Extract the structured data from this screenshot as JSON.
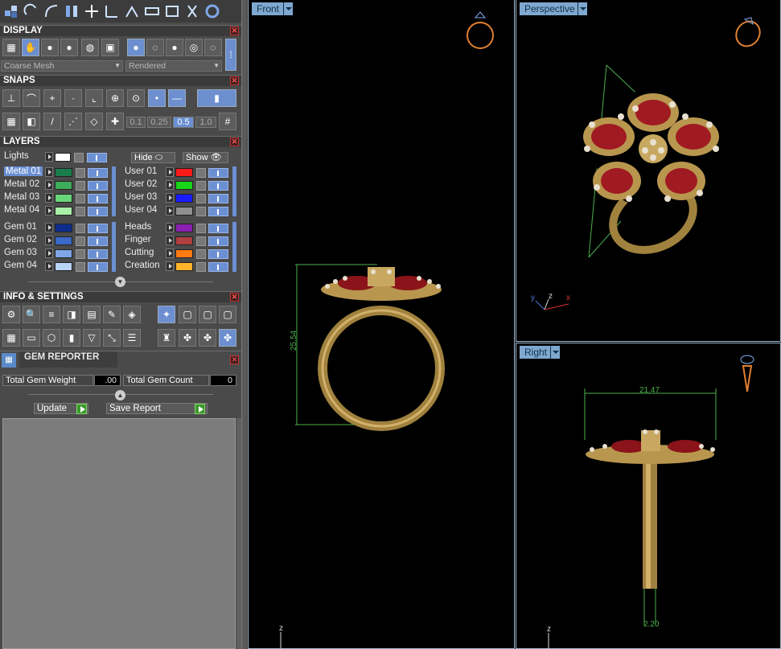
{
  "display": {
    "title": "DISPLAY",
    "mesh_mode": "Coarse Mesh",
    "render_mode": "Rendered"
  },
  "snaps": {
    "title": "SNAPS",
    "increments": [
      "0.1",
      "0.25",
      "0.5",
      "1.0"
    ],
    "active_increment": "0.5"
  },
  "layers": {
    "title": "LAYERS",
    "lights_label": "Lights",
    "hide_label": "Hide",
    "show_label": "Show",
    "metal": [
      {
        "name": "Metal 01",
        "color": "#1a7d4b",
        "selected": true
      },
      {
        "name": "Metal 02",
        "color": "#3fae5c"
      },
      {
        "name": "Metal 03",
        "color": "#6ad67a"
      },
      {
        "name": "Metal 04",
        "color": "#a8f0a8"
      }
    ],
    "user": [
      {
        "name": "User 01",
        "color": "#ff1a1a"
      },
      {
        "name": "User 02",
        "color": "#18d618"
      },
      {
        "name": "User 03",
        "color": "#1a1aff"
      },
      {
        "name": "User 04",
        "color": "#909090"
      }
    ],
    "gem": [
      {
        "name": "Gem 01",
        "color": "#0e2d8a"
      },
      {
        "name": "Gem 02",
        "color": "#3a69c8"
      },
      {
        "name": "Gem 03",
        "color": "#7ea6e8"
      },
      {
        "name": "Gem 04",
        "color": "#b9d3f6"
      }
    ],
    "other": [
      {
        "name": "Heads",
        "color": "#8a1fb0"
      },
      {
        "name": "Finger",
        "color": "#b04040"
      },
      {
        "name": "Cutting",
        "color": "#ff7a12"
      },
      {
        "name": "Creation",
        "color": "#ffb42a"
      }
    ]
  },
  "info": {
    "title": "INFO & SETTINGS"
  },
  "gem_reporter": {
    "title": "GEM REPORTER",
    "weight_label": "Total Gem Weight",
    "weight_value": ".00",
    "count_label": "Total Gem Count",
    "count_value": "0",
    "update_label": "Update",
    "save_label": "Save Report"
  },
  "viewports": {
    "front": {
      "label": "Front",
      "dim": "25.54",
      "axis_z": "z"
    },
    "perspective": {
      "label": "Perspective",
      "axis_x": "x",
      "axis_y": "y",
      "axis_z": "z"
    },
    "right": {
      "label": "Right",
      "dim_width": "21.47",
      "dim_bottom": "2.20",
      "axis_z": "z"
    }
  },
  "colors": {
    "accent": "#6b8fd3",
    "viewport_label": "#7ea8cf",
    "gold": "#b8964e",
    "ruby": "#a01a22",
    "dim_green": "#4cb04c"
  }
}
